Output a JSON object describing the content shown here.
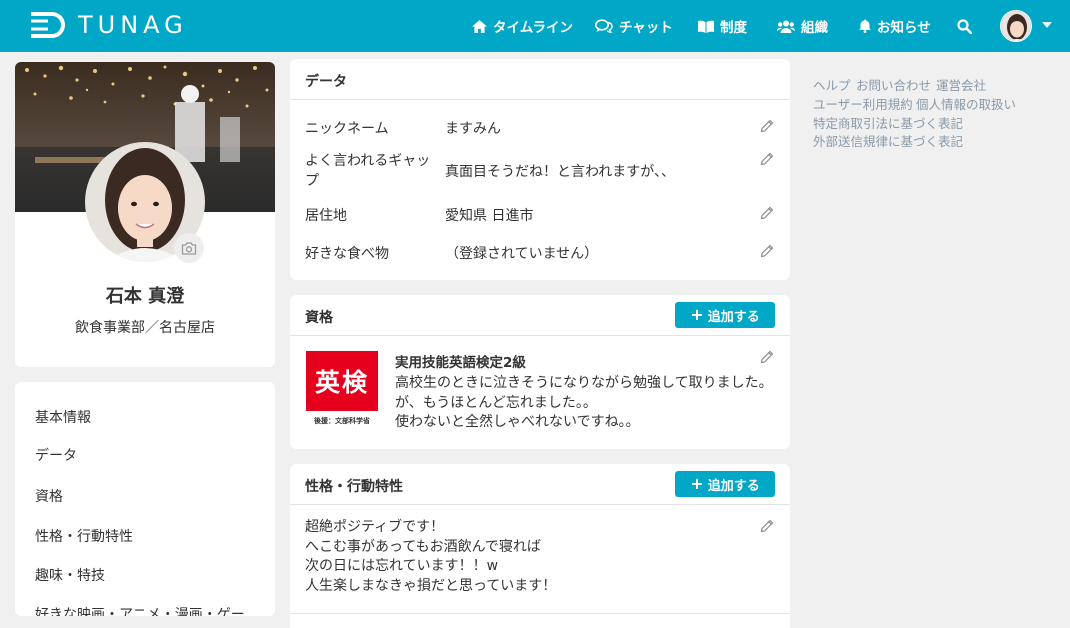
{
  "header": {
    "brand": "TUNAG",
    "nav": [
      {
        "label": "タイムライン",
        "icon": "home-icon"
      },
      {
        "label": "チャット",
        "icon": "chat-icon"
      },
      {
        "label": "制度",
        "icon": "book-icon"
      },
      {
        "label": "組織",
        "icon": "users-icon"
      },
      {
        "label": "お知らせ",
        "icon": "bell-icon"
      }
    ],
    "accent": "#00a7c6"
  },
  "profile": {
    "name": "石本 真澄",
    "department": "飲食事業部／名古屋店"
  },
  "sidenav": {
    "items": [
      {
        "label": "基本情報"
      },
      {
        "label": "データ"
      },
      {
        "label": "資格"
      },
      {
        "label": "性格・行動特性"
      },
      {
        "label": "趣味・特技"
      },
      {
        "label": "好きな映画・アニメ・漫画・ゲー"
      }
    ]
  },
  "data_panel": {
    "title": "データ",
    "rows": [
      {
        "label": "ニックネーム",
        "value": "ますみん"
      },
      {
        "label": "よく言われるギャップ",
        "value": "真面目そうだね！と言われますが、、"
      },
      {
        "label": "居住地",
        "value": "愛知県 日進市"
      },
      {
        "label": "好きな食べ物",
        "value": "（登録されていません）"
      }
    ]
  },
  "qual_panel": {
    "title": "資格",
    "add_label": "追加する",
    "badge_text": "英検",
    "badge_caption": "後援：文部科学省",
    "item_title": "実用技能英語検定2級",
    "lines": [
      "高校生のときに泣きそうになりながら勉強して取りました。",
      "が、もうほとんど忘れました。。",
      "使わないと全然しゃべれないですね。。"
    ]
  },
  "personality_panel": {
    "title": "性格・行動特性",
    "add_label": "追加する",
    "lines": [
      "超絶ポジティブです！",
      "へこむ事があってもお酒飲んで寝れば",
      "次の日には忘れています！！w",
      "人生楽しまなきゃ損だと思っています！"
    ]
  },
  "footer": {
    "links": [
      "ヘルプ",
      "お問い合わせ",
      "運営会社",
      "ユーザー利用規約",
      "個人情報の取扱い",
      "特定商取引法に基づく表記",
      "外部送信規律に基づく表記"
    ]
  }
}
